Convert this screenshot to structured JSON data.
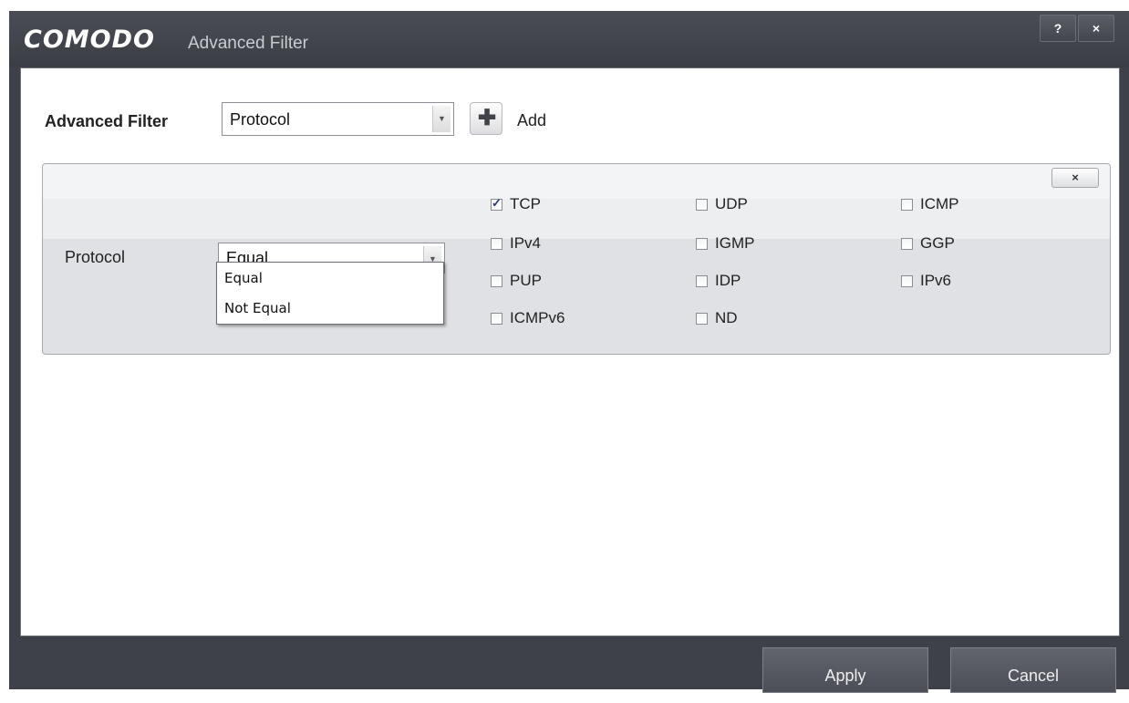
{
  "window": {
    "brand": "COMODO",
    "title": "Advanced Filter",
    "help_label": "?",
    "close_label": "×"
  },
  "filter_bar": {
    "label": "Advanced Filter",
    "selected_value": "Protocol",
    "add_label": "Add"
  },
  "protocol_panel": {
    "close_label": "×",
    "field_label": "Protocol",
    "operator_value": "Equal",
    "operator_options": [
      "Equal",
      "Not Equal"
    ],
    "checkboxes": [
      {
        "label": "TCP",
        "checked": true
      },
      {
        "label": "UDP",
        "checked": false
      },
      {
        "label": "ICMP",
        "checked": false
      },
      {
        "label": "IPv4",
        "checked": false
      },
      {
        "label": "IGMP",
        "checked": false
      },
      {
        "label": "GGP",
        "checked": false
      },
      {
        "label": "PUP",
        "checked": false
      },
      {
        "label": "IDP",
        "checked": false
      },
      {
        "label": "IPv6",
        "checked": false
      },
      {
        "label": "ICMPv6",
        "checked": false
      },
      {
        "label": "ND",
        "checked": false
      }
    ]
  },
  "footer": {
    "apply_label": "Apply",
    "cancel_label": "Cancel"
  }
}
